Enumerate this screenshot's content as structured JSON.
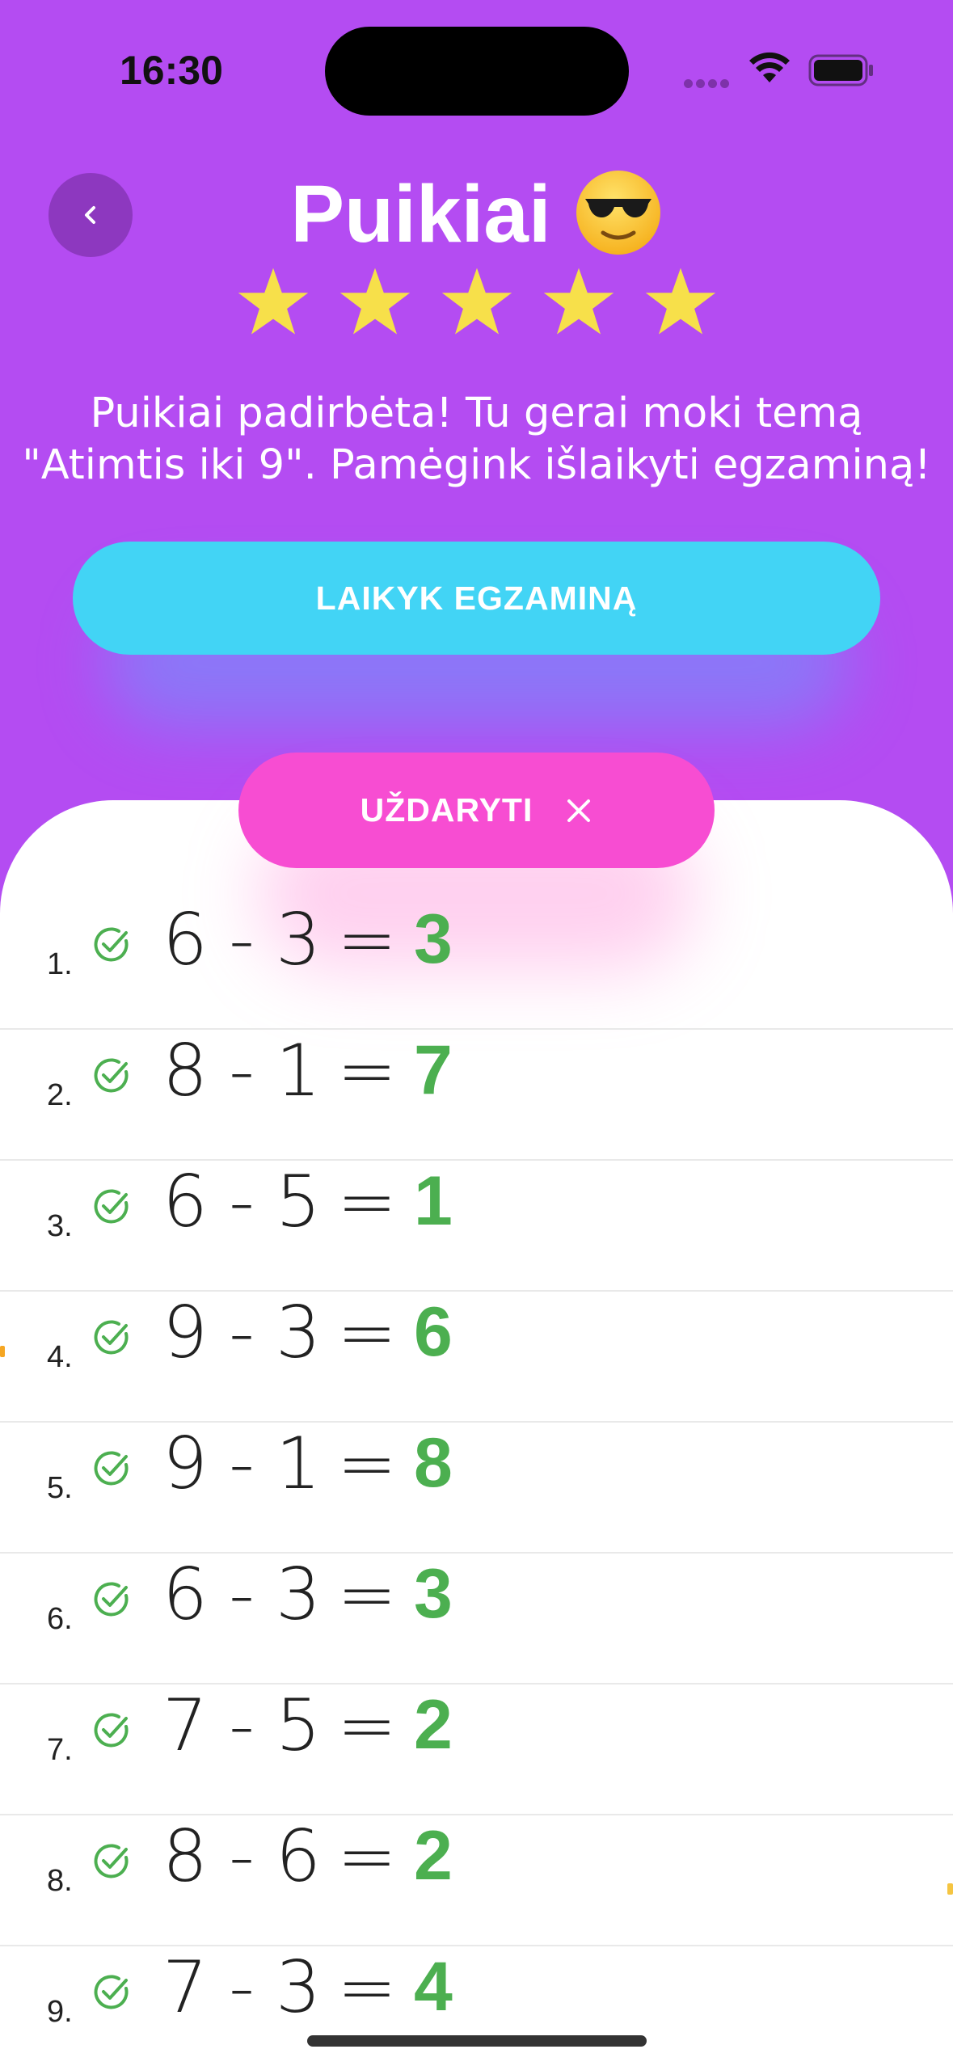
{
  "status_bar": {
    "time": "16:30"
  },
  "header": {
    "title": "Puikiai",
    "emoji": "sunglasses-face",
    "stars": 5,
    "message": "Puikiai padirbėta! Tu gerai moki temą \"Atimtis iki 9\". Pamėgink išlaikyti egzaminą!"
  },
  "buttons": {
    "exam_label": "LAIKYK EGZAMINĄ",
    "close_label": "UŽDARYTI"
  },
  "colors": {
    "background": "#b44cf2",
    "exam_button": "#42d4f5",
    "close_button": "#f74dd2",
    "correct": "#4caf50",
    "star": "#f7e04a"
  },
  "results": [
    {
      "num": "1.",
      "a": "6",
      "op": "-",
      "b": "3",
      "eq": "=",
      "answer": "3"
    },
    {
      "num": "2.",
      "a": "8",
      "op": "-",
      "b": "1",
      "eq": "=",
      "answer": "7"
    },
    {
      "num": "3.",
      "a": "6",
      "op": "-",
      "b": "5",
      "eq": "=",
      "answer": "1"
    },
    {
      "num": "4.",
      "a": "9",
      "op": "-",
      "b": "3",
      "eq": "=",
      "answer": "6"
    },
    {
      "num": "5.",
      "a": "9",
      "op": "-",
      "b": "1",
      "eq": "=",
      "answer": "8"
    },
    {
      "num": "6.",
      "a": "6",
      "op": "-",
      "b": "3",
      "eq": "=",
      "answer": "3"
    },
    {
      "num": "7.",
      "a": "7",
      "op": "-",
      "b": "5",
      "eq": "=",
      "answer": "2"
    },
    {
      "num": "8.",
      "a": "8",
      "op": "-",
      "b": "6",
      "eq": "=",
      "answer": "2"
    },
    {
      "num": "9.",
      "a": "7",
      "op": "-",
      "b": "3",
      "eq": "=",
      "answer": "4"
    }
  ]
}
